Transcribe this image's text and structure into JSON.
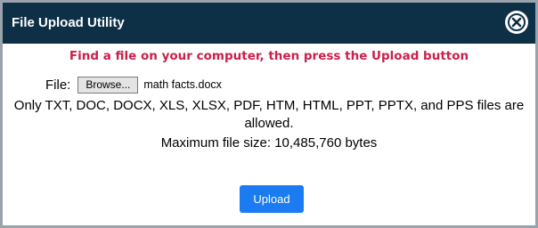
{
  "dialog": {
    "title": "File Upload Utility",
    "close_icon": "close-circle-icon"
  },
  "instruction": "Find a file on your computer, then press the Upload button",
  "file_picker": {
    "label": "File:",
    "browse_label": "Browse...",
    "selected_file": "math facts.docx"
  },
  "allowed_types_text": "Only TXT, DOC, DOCX, XLS, XLSX, PDF, HTM, HTML, PPT, PPTX, and PPS files are allowed.",
  "max_size_text": "Maximum file size: 10,485,760 bytes",
  "upload_label": "Upload",
  "colors": {
    "titlebar": "#0e3047",
    "instruction": "#cc1f4a",
    "upload_button": "#1a7cf0"
  }
}
